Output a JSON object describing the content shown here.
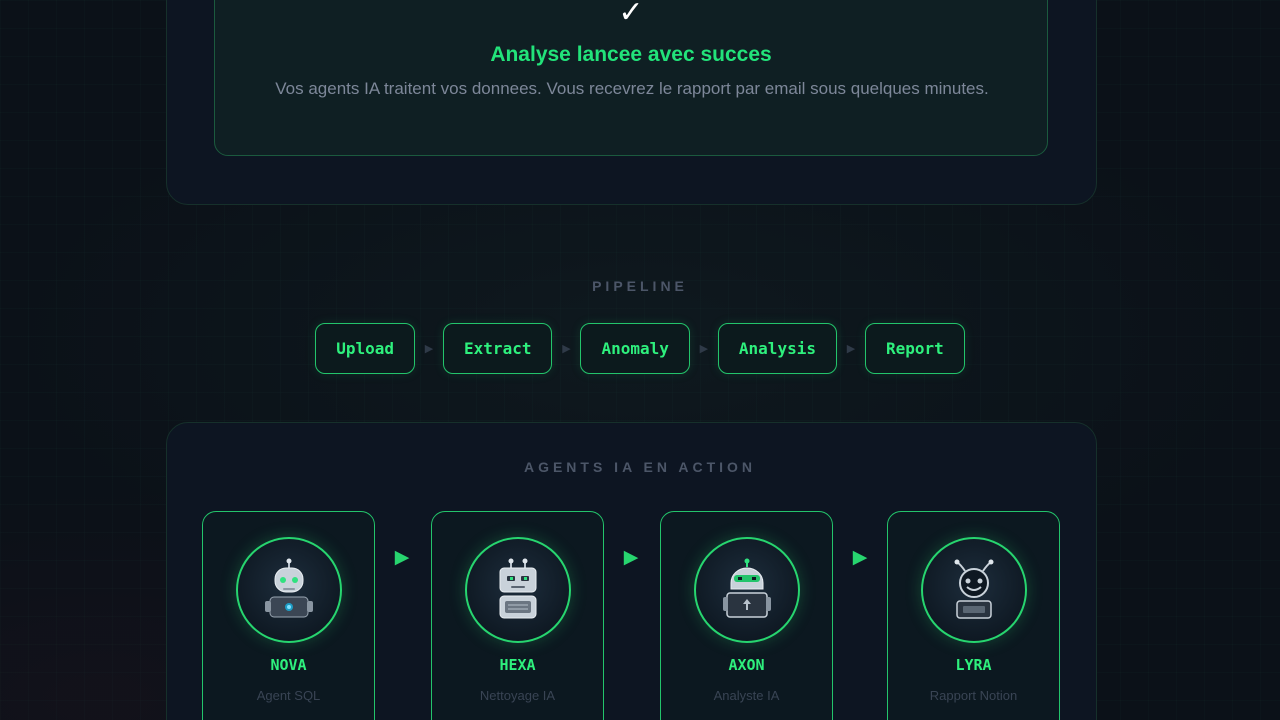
{
  "success": {
    "title": "Analyse lancee avec succes",
    "message": "Vos agents IA traitent vos donnees. Vous recevrez le rapport par email sous quelques minutes.",
    "icon": "checkmark-icon"
  },
  "pipeline": {
    "label": "PIPELINE",
    "steps": [
      "Upload",
      "Extract",
      "Anomaly",
      "Analysis",
      "Report"
    ]
  },
  "agents_section": {
    "label": "AGENTS IA EN ACTION",
    "agents": [
      {
        "name": "NOVA",
        "role": "Agent SQL",
        "icon": "robot-icon"
      },
      {
        "name": "HEXA",
        "role": "Nettoyage IA",
        "icon": "robot-icon"
      },
      {
        "name": "AXON",
        "role": "Analyste IA",
        "icon": "robot-icon"
      },
      {
        "name": "LYRA",
        "role": "Rapport Notion",
        "icon": "robot-icon"
      }
    ]
  },
  "colors": {
    "accent": "#22e37a",
    "background": "#0b1118",
    "card": "#0d1522",
    "muted_text": "#7d8799"
  }
}
